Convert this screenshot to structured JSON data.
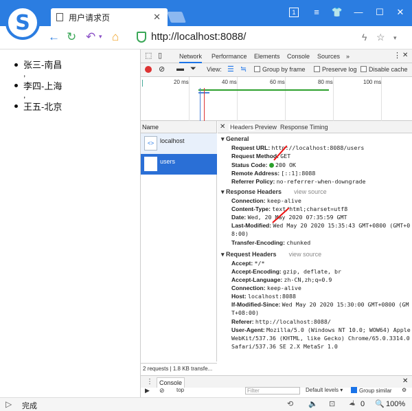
{
  "browser": {
    "tab_title": "用户请求页",
    "url": "http://localhost:8088/",
    "status_text": "完成",
    "zoom": "100%",
    "download_count": "0",
    "colors": {
      "titlebar": "#2b7de1",
      "secure": "#3aa757"
    }
  },
  "page": {
    "items": [
      "张三-南昌",
      "李四-上海",
      "王五-北京"
    ],
    "separator": ","
  },
  "devtools": {
    "tabs": [
      "Network",
      "Performance",
      "Elements",
      "Console",
      "Sources",
      "»"
    ],
    "toolbar": {
      "view_label": "View:",
      "group_by_frame": "Group by frame",
      "preserve_log": "Preserve log",
      "disable_cache": "Disable cache"
    },
    "timeline_ticks": [
      "20 ms",
      "40 ms",
      "60 ms",
      "80 ms",
      "100 ms"
    ],
    "name_header": "Name",
    "requests": [
      {
        "name": "localhost"
      },
      {
        "name": "users"
      }
    ],
    "summary": "2 requests | 1.8 KB transfe...",
    "detail_tabs": [
      "Headers",
      "Preview",
      "Response",
      "Timing"
    ],
    "general": {
      "title": "General",
      "rows": [
        {
          "k": "Request URL:",
          "v": "http://localhost:8088/users"
        },
        {
          "k": "Request Method:",
          "v": "GET"
        },
        {
          "k": "Status Code:",
          "v": "200 OK"
        },
        {
          "k": "Remote Address:",
          "v": "[::1]:8088"
        },
        {
          "k": "Referrer Policy:",
          "v": "no-referrer-when-downgrade"
        }
      ]
    },
    "response_headers": {
      "title": "Response Headers",
      "view_source": "view source",
      "rows": [
        {
          "k": "Connection:",
          "v": "keep-alive"
        },
        {
          "k": "Content-Type:",
          "v": "text/html;charset=utf8"
        },
        {
          "k": "Date:",
          "v": "Wed, 20 May 2020 07:35:59 GMT"
        },
        {
          "k": "Last-Modified:",
          "v": "Wed May 20 2020 15:35:43 GMT+0800 (GMT+0"
        },
        {
          "k": "",
          "v": "8:00)"
        },
        {
          "k": "Transfer-Encoding:",
          "v": "chunked"
        }
      ]
    },
    "request_headers": {
      "title": "Request Headers",
      "view_source": "view source",
      "rows": [
        {
          "k": "Accept:",
          "v": "*/*"
        },
        {
          "k": "Accept-Encoding:",
          "v": "gzip, deflate, br"
        },
        {
          "k": "Accept-Language:",
          "v": "zh-CN,zh;q=0.9"
        },
        {
          "k": "Connection:",
          "v": "keep-alive"
        },
        {
          "k": "Host:",
          "v": "localhost:8088"
        },
        {
          "k": "If-Modified-Since:",
          "v": "Wed May 20 2020 15:30:00 GMT+0800 (GM"
        },
        {
          "k": "",
          "v": "T+08:00)"
        },
        {
          "k": "Referer:",
          "v": "http://localhost:8088/"
        },
        {
          "k": "User-Agent:",
          "v": "Mozilla/5.0 (Windows NT 10.0; WOW64) Apple"
        },
        {
          "k": "",
          "v": "WebKit/537.36 (KHTML, like Gecko) Chrome/65.0.3314.0"
        },
        {
          "k": "",
          "v": "Safari/537.36 SE 2.X MetaSr 1.0"
        }
      ]
    },
    "console": {
      "tab": "Console",
      "context": "top",
      "filter_placeholder": "Filter",
      "levels": "Default levels ▾",
      "group_similar": "Group similar"
    }
  }
}
